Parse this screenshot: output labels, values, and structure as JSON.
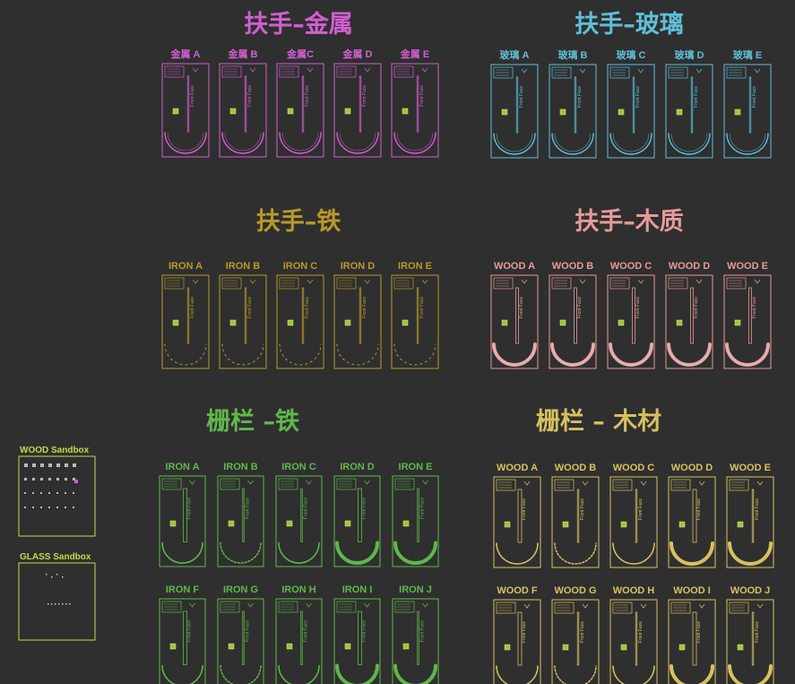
{
  "colors": {
    "background": "#2f2f2f",
    "metal": "#d25fd2",
    "glass": "#5fbfd8",
    "iron_rail": "#b89a2a",
    "wood_rail": "#e89a9a",
    "iron_fence": "#5fb84a",
    "wood_fence": "#d8c060",
    "sandbox": "#c8d84a"
  },
  "groups": [
    {
      "id": "metal",
      "title": "扶手–金属",
      "color_key": "metal",
      "cards": [
        "金属 A",
        "金属 B",
        "金属C",
        "金属 D",
        "金属 E"
      ],
      "style": "pipe"
    },
    {
      "id": "glass",
      "title": "扶手–玻璃",
      "color_key": "glass",
      "cards": [
        "玻璃 A",
        "玻璃 B",
        "玻璃 C",
        "玻璃 D",
        "玻璃 E"
      ],
      "style": "pipe"
    },
    {
      "id": "iron_rail",
      "title": "扶手–铁",
      "color_key": "iron_rail",
      "cards": [
        "IRON A",
        "IRON B",
        "IRON C",
        "IRON D",
        "IRON E"
      ],
      "style": "dotted"
    },
    {
      "id": "wood_rail",
      "title": "扶手–木质",
      "color_key": "wood_rail",
      "cards": [
        "WOOD A",
        "WOOD B",
        "WOOD C",
        "WOOD D",
        "WOOD E"
      ],
      "style": "thick"
    },
    {
      "id": "iron_fence",
      "title": "栅栏 –铁",
      "color_key": "iron_fence",
      "cards": [
        "IRON A",
        "IRON B",
        "IRON C",
        "IRON D",
        "IRON E",
        "IRON F",
        "IRON G",
        "IRON H",
        "IRON I",
        "IRON J"
      ],
      "style": "fence"
    },
    {
      "id": "wood_fence",
      "title": "栅栏 – 木材",
      "color_key": "wood_fence",
      "cards": [
        "WOOD A",
        "WOOD B",
        "WOOD C",
        "WOOD D",
        "WOOD E",
        "WOOD F",
        "WOOD G",
        "WOOD H",
        "WOOD I",
        "WOOD J"
      ],
      "style": "fence"
    }
  ],
  "sandboxes": [
    {
      "id": "wood_sandbox",
      "label": "WOOD Sandbox"
    },
    {
      "id": "glass_sandbox",
      "label": "GLASS Sandbox"
    }
  ],
  "card_inner_text": "Front Face"
}
